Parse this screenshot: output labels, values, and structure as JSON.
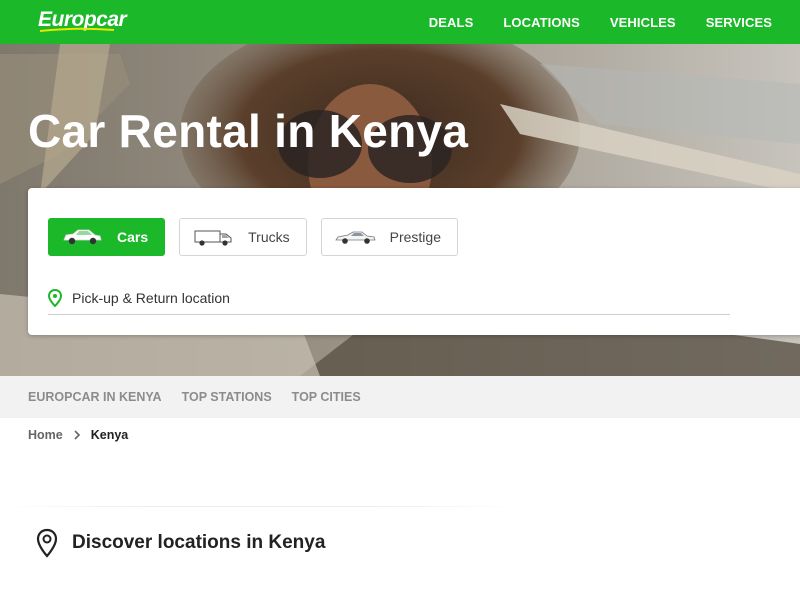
{
  "header": {
    "logo_text": "Europcar",
    "nav": [
      {
        "label": "DEALS"
      },
      {
        "label": "LOCATIONS"
      },
      {
        "label": "VEHICLES"
      },
      {
        "label": "SERVICES"
      }
    ]
  },
  "hero": {
    "title": "Car Rental in Kenya"
  },
  "booking": {
    "vehicle_tabs": [
      {
        "label": "Cars",
        "icon": "car-icon",
        "active": true
      },
      {
        "label": "Trucks",
        "icon": "truck-icon",
        "active": false
      },
      {
        "label": "Prestige",
        "icon": "prestige-car-icon",
        "active": false
      }
    ],
    "location_placeholder": "Pick-up & Return location"
  },
  "subnav": {
    "items": [
      {
        "label": "EUROPCAR IN KENYA"
      },
      {
        "label": "TOP STATIONS"
      },
      {
        "label": "TOP CITIES"
      }
    ]
  },
  "breadcrumb": {
    "home": "Home",
    "current": "Kenya"
  },
  "discover": {
    "title": "Discover locations in Kenya"
  },
  "colors": {
    "brand_green": "#1bb82a",
    "subnav_bg": "#f2f2f2"
  }
}
